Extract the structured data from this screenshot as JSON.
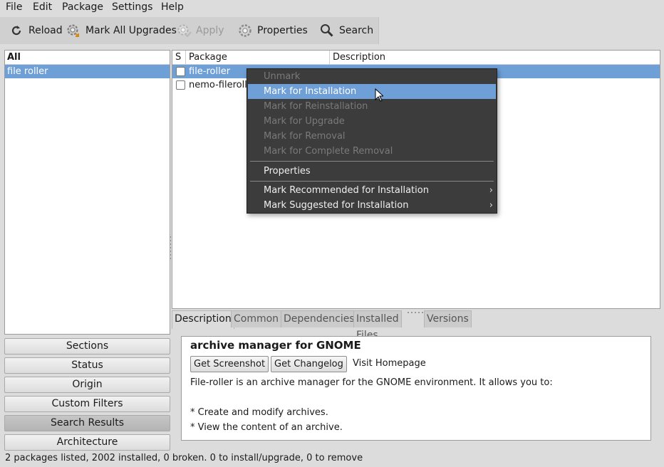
{
  "menubar": {
    "items": [
      "File",
      "Edit",
      "Package",
      "Settings",
      "Help"
    ]
  },
  "toolbar": {
    "reload": "Reload",
    "mark_all_upgrades": "Mark All Upgrades",
    "apply": "Apply",
    "properties": "Properties",
    "search": "Search"
  },
  "filters": {
    "header": "All",
    "selected": "file roller",
    "buttons": [
      "Sections",
      "Status",
      "Origin",
      "Custom Filters",
      "Search Results",
      "Architecture"
    ],
    "active_button": "Search Results"
  },
  "packages": {
    "columns": [
      "S",
      "Package",
      "Description"
    ],
    "rows": [
      {
        "name": "file-roller",
        "checked": false,
        "selected": true
      },
      {
        "name": "nemo-fileroll",
        "checked": false,
        "selected": false
      }
    ]
  },
  "context_menu": {
    "items": [
      {
        "label": "Unmark",
        "enabled": false
      },
      {
        "label": "Mark for Installation",
        "enabled": true,
        "hover": true
      },
      {
        "label": "Mark for Reinstallation",
        "enabled": false
      },
      {
        "label": "Mark for Upgrade",
        "enabled": false
      },
      {
        "label": "Mark for Removal",
        "enabled": false
      },
      {
        "label": "Mark for Complete Removal",
        "enabled": false
      },
      {
        "label": "Properties",
        "enabled": true
      },
      {
        "label": "Mark Recommended for Installation",
        "enabled": true,
        "submenu": true
      },
      {
        "label": "Mark Suggested for Installation",
        "enabled": true,
        "submenu": true
      }
    ]
  },
  "tabs": [
    "Description",
    "Common",
    "Dependencies",
    "Installed Files",
    "Versions"
  ],
  "description": {
    "title": "archive manager for GNOME",
    "get_screenshot": "Get Screenshot",
    "get_changelog": "Get Changelog",
    "visit_homepage": "Visit Homepage",
    "intro": "File-roller is an archive manager for the GNOME environment. It allows you to:",
    "bullets": [
      "* Create and modify archives.",
      "* View the content of an archive."
    ]
  },
  "status": {
    "text": "2 packages listed, 2002 installed, 0 broken. 0 to install/upgrade, 0 to remove"
  },
  "colors": {
    "selection": "#6e9fd6",
    "menu_bg": "#3c3c3c",
    "window_bg": "#dcdcdc"
  }
}
